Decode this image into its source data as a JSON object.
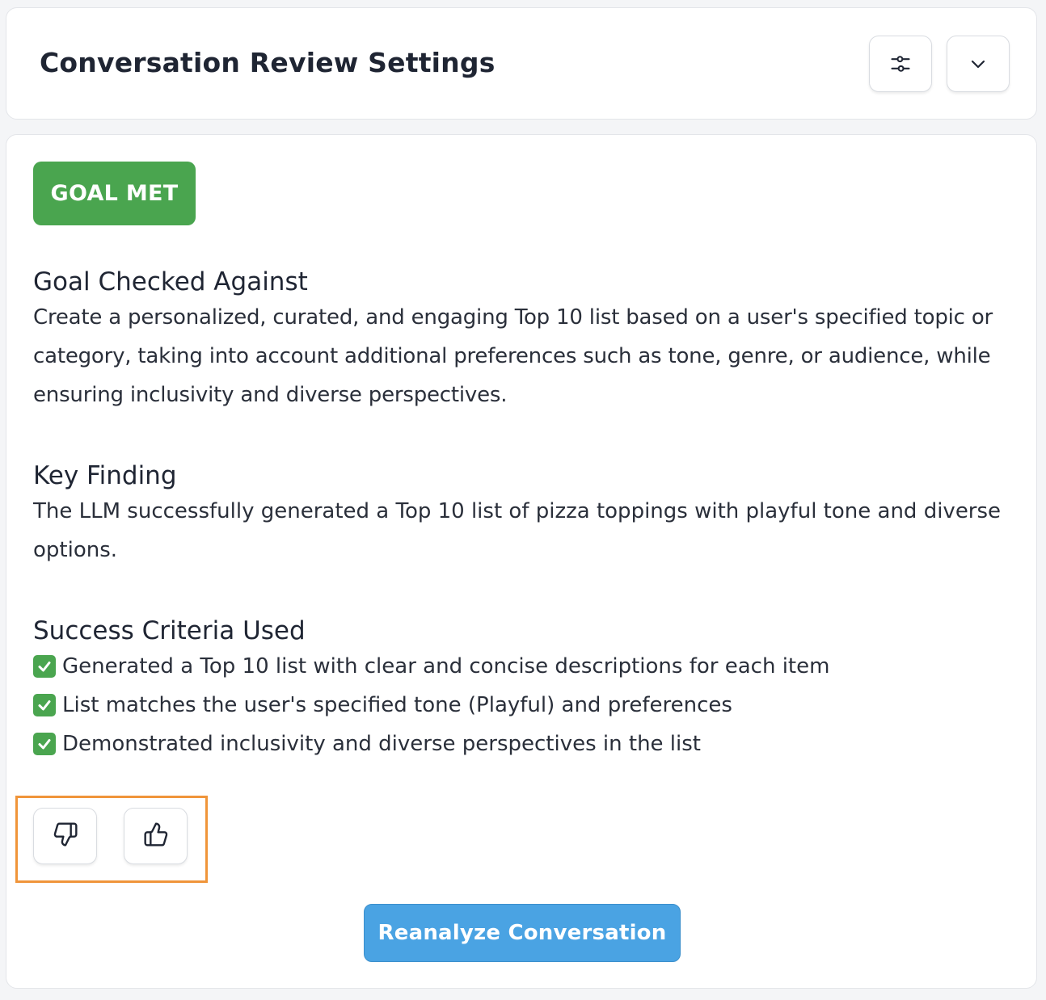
{
  "header": {
    "title": "Conversation Review Settings",
    "filter_icon": "sliders-icon",
    "collapse_icon": "chevron-down-icon"
  },
  "result": {
    "status_badge": "GOAL MET",
    "status_color": "#4aa54f",
    "goal": {
      "heading": "Goal Checked Against",
      "body": "Create a personalized, curated, and engaging Top 10 list based on a user's specified topic or category, taking into account additional preferences such as tone, genre, or audience, while ensuring inclusivity and diverse perspectives."
    },
    "finding": {
      "heading": "Key Finding",
      "body": "The LLM successfully generated a Top 10 list of pizza toppings with playful tone and diverse options."
    },
    "criteria": {
      "heading": "Success Criteria Used",
      "items": [
        "Generated a Top 10 list with clear and concise descriptions for each item",
        "List matches the user's specified tone (Playful) and preferences",
        "Demonstrated inclusivity and diverse perspectives in the list"
      ],
      "item_icon": "check-mark-icon"
    }
  },
  "feedback": {
    "thumbs_down_icon": "thumbs-down-icon",
    "thumbs_up_icon": "thumbs-up-icon",
    "highlight_color": "#f0953a"
  },
  "actions": {
    "reanalyze_label": "Reanalyze Conversation",
    "reanalyze_color": "#4aa3e3"
  }
}
